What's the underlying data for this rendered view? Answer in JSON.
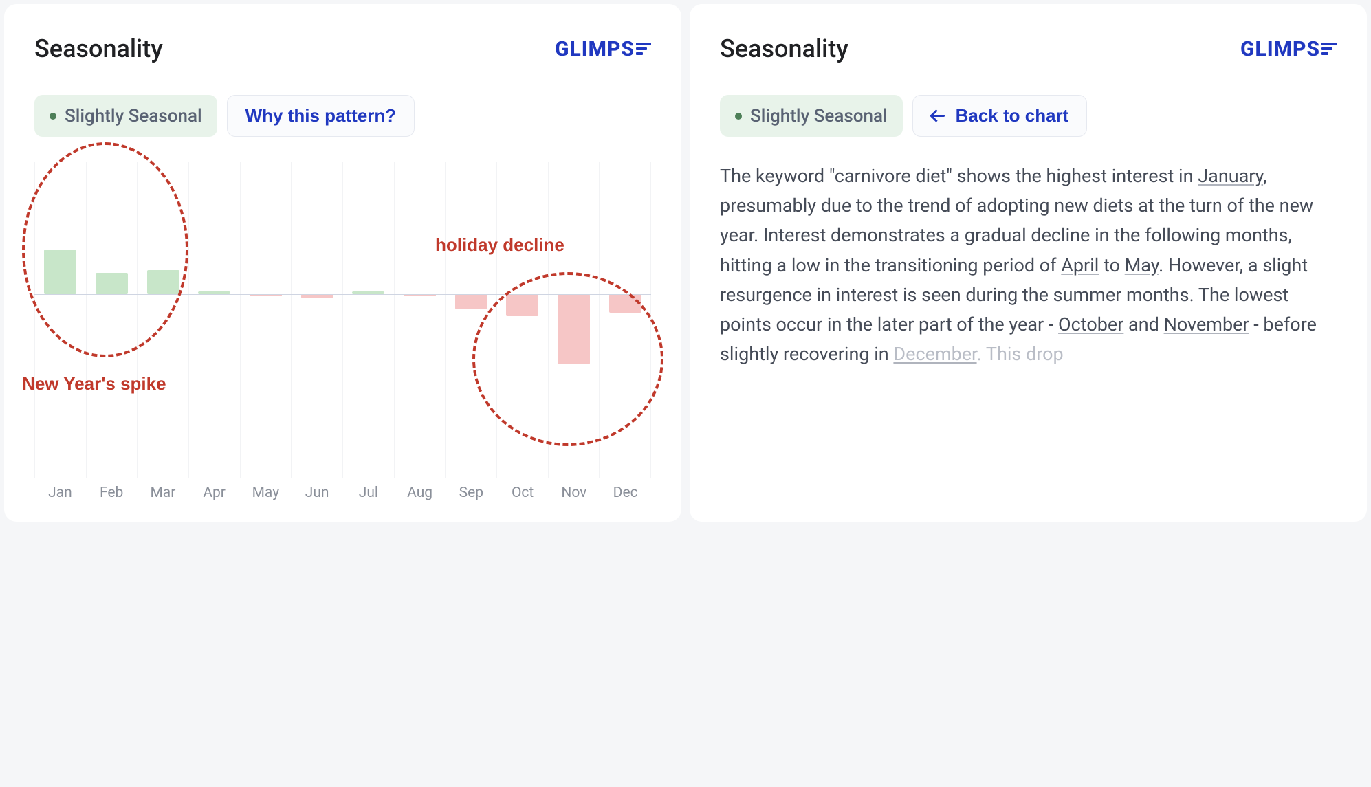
{
  "left": {
    "title": "Seasonality",
    "brand": "GLIMPS",
    "badge": "Slightly Seasonal",
    "button": "Why this pattern?",
    "annotation1": "New Year's spike",
    "annotation2": "holiday decline"
  },
  "right": {
    "title": "Seasonality",
    "brand": "GLIMPS",
    "badge": "Slightly Seasonal",
    "button": "Back to chart",
    "p1a": "The keyword \"carnivore diet\" shows the highest interest in ",
    "p1b": "January",
    "p1c": ", presumably due to the trend of adopting new diets at the turn of the new year. Interest demonstrates a gradual decline in the following months, hitting a low in the transitioning period of ",
    "p1d": "April",
    "p1e": " to ",
    "p1f": "May",
    "p1g": ". However, a slight resurgence in interest is seen during the summer months. The lowest points occur in the later part of the year - ",
    "p1h": "October",
    "p1i": " and ",
    "p1j": "November",
    "p1k": " - before slightly recovering in ",
    "p1l": "December",
    "p1m": ". This drop"
  },
  "chart_data": {
    "type": "bar",
    "title": "Seasonality",
    "categories": [
      "Jan",
      "Feb",
      "Mar",
      "Apr",
      "May",
      "Jun",
      "Jul",
      "Aug",
      "Sep",
      "Oct",
      "Nov",
      "Dec"
    ],
    "values": [
      34,
      16,
      18,
      2,
      -1,
      -2,
      2,
      -1,
      -8,
      -12,
      -38,
      -10
    ],
    "xlabel": "",
    "ylabel": "",
    "ylim": [
      -100,
      100
    ],
    "colors": {
      "positive": "#c8e6c9",
      "negative": "#f6c6c6"
    }
  }
}
